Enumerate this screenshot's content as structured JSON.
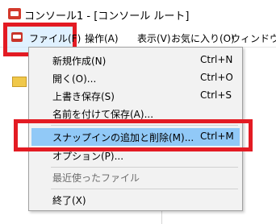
{
  "window": {
    "title": "コンソール1 - [コンソール ルート]"
  },
  "menubar": {
    "items": [
      {
        "label": "ファイル(F)"
      },
      {
        "label": "操作(A)"
      },
      {
        "label": "表示(V)"
      },
      {
        "label": "お気に入り(O)"
      },
      {
        "label": "ウィンドウ("
      }
    ]
  },
  "file_menu": {
    "items": [
      {
        "label": "新規作成(N)",
        "shortcut": "Ctrl+N"
      },
      {
        "label": "開く(O)...",
        "shortcut": "Ctrl+O"
      },
      {
        "label": "上書き保存(S)",
        "shortcut": "Ctrl+S"
      },
      {
        "label": "名前を付けて保存(A)...",
        "shortcut": ""
      },
      {
        "label": "スナップインの追加と削除(M)...",
        "shortcut": "Ctrl+M",
        "highlighted": true
      },
      {
        "label": "オプション(P)...",
        "shortcut": ""
      },
      {
        "label": "最近使ったファイル",
        "shortcut": "",
        "disabled": true
      },
      {
        "label": "終了(X)",
        "shortcut": ""
      }
    ]
  },
  "annotations": {
    "highlight_color": "#e31b23",
    "selection_color": "#91c9f7"
  }
}
